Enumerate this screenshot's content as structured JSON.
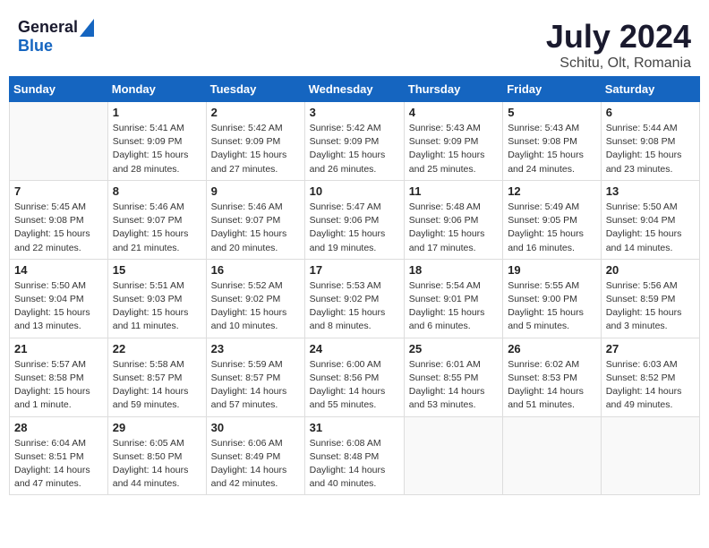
{
  "logo": {
    "general": "General",
    "blue": "Blue"
  },
  "title": "July 2024",
  "location": "Schitu, Olt, Romania",
  "weekdays": [
    "Sunday",
    "Monday",
    "Tuesday",
    "Wednesday",
    "Thursday",
    "Friday",
    "Saturday"
  ],
  "weeks": [
    [
      {
        "day": "",
        "info": ""
      },
      {
        "day": "1",
        "info": "Sunrise: 5:41 AM\nSunset: 9:09 PM\nDaylight: 15 hours\nand 28 minutes."
      },
      {
        "day": "2",
        "info": "Sunrise: 5:42 AM\nSunset: 9:09 PM\nDaylight: 15 hours\nand 27 minutes."
      },
      {
        "day": "3",
        "info": "Sunrise: 5:42 AM\nSunset: 9:09 PM\nDaylight: 15 hours\nand 26 minutes."
      },
      {
        "day": "4",
        "info": "Sunrise: 5:43 AM\nSunset: 9:09 PM\nDaylight: 15 hours\nand 25 minutes."
      },
      {
        "day": "5",
        "info": "Sunrise: 5:43 AM\nSunset: 9:08 PM\nDaylight: 15 hours\nand 24 minutes."
      },
      {
        "day": "6",
        "info": "Sunrise: 5:44 AM\nSunset: 9:08 PM\nDaylight: 15 hours\nand 23 minutes."
      }
    ],
    [
      {
        "day": "7",
        "info": "Sunrise: 5:45 AM\nSunset: 9:08 PM\nDaylight: 15 hours\nand 22 minutes."
      },
      {
        "day": "8",
        "info": "Sunrise: 5:46 AM\nSunset: 9:07 PM\nDaylight: 15 hours\nand 21 minutes."
      },
      {
        "day": "9",
        "info": "Sunrise: 5:46 AM\nSunset: 9:07 PM\nDaylight: 15 hours\nand 20 minutes."
      },
      {
        "day": "10",
        "info": "Sunrise: 5:47 AM\nSunset: 9:06 PM\nDaylight: 15 hours\nand 19 minutes."
      },
      {
        "day": "11",
        "info": "Sunrise: 5:48 AM\nSunset: 9:06 PM\nDaylight: 15 hours\nand 17 minutes."
      },
      {
        "day": "12",
        "info": "Sunrise: 5:49 AM\nSunset: 9:05 PM\nDaylight: 15 hours\nand 16 minutes."
      },
      {
        "day": "13",
        "info": "Sunrise: 5:50 AM\nSunset: 9:04 PM\nDaylight: 15 hours\nand 14 minutes."
      }
    ],
    [
      {
        "day": "14",
        "info": "Sunrise: 5:50 AM\nSunset: 9:04 PM\nDaylight: 15 hours\nand 13 minutes."
      },
      {
        "day": "15",
        "info": "Sunrise: 5:51 AM\nSunset: 9:03 PM\nDaylight: 15 hours\nand 11 minutes."
      },
      {
        "day": "16",
        "info": "Sunrise: 5:52 AM\nSunset: 9:02 PM\nDaylight: 15 hours\nand 10 minutes."
      },
      {
        "day": "17",
        "info": "Sunrise: 5:53 AM\nSunset: 9:02 PM\nDaylight: 15 hours\nand 8 minutes."
      },
      {
        "day": "18",
        "info": "Sunrise: 5:54 AM\nSunset: 9:01 PM\nDaylight: 15 hours\nand 6 minutes."
      },
      {
        "day": "19",
        "info": "Sunrise: 5:55 AM\nSunset: 9:00 PM\nDaylight: 15 hours\nand 5 minutes."
      },
      {
        "day": "20",
        "info": "Sunrise: 5:56 AM\nSunset: 8:59 PM\nDaylight: 15 hours\nand 3 minutes."
      }
    ],
    [
      {
        "day": "21",
        "info": "Sunrise: 5:57 AM\nSunset: 8:58 PM\nDaylight: 15 hours\nand 1 minute."
      },
      {
        "day": "22",
        "info": "Sunrise: 5:58 AM\nSunset: 8:57 PM\nDaylight: 14 hours\nand 59 minutes."
      },
      {
        "day": "23",
        "info": "Sunrise: 5:59 AM\nSunset: 8:57 PM\nDaylight: 14 hours\nand 57 minutes."
      },
      {
        "day": "24",
        "info": "Sunrise: 6:00 AM\nSunset: 8:56 PM\nDaylight: 14 hours\nand 55 minutes."
      },
      {
        "day": "25",
        "info": "Sunrise: 6:01 AM\nSunset: 8:55 PM\nDaylight: 14 hours\nand 53 minutes."
      },
      {
        "day": "26",
        "info": "Sunrise: 6:02 AM\nSunset: 8:53 PM\nDaylight: 14 hours\nand 51 minutes."
      },
      {
        "day": "27",
        "info": "Sunrise: 6:03 AM\nSunset: 8:52 PM\nDaylight: 14 hours\nand 49 minutes."
      }
    ],
    [
      {
        "day": "28",
        "info": "Sunrise: 6:04 AM\nSunset: 8:51 PM\nDaylight: 14 hours\nand 47 minutes."
      },
      {
        "day": "29",
        "info": "Sunrise: 6:05 AM\nSunset: 8:50 PM\nDaylight: 14 hours\nand 44 minutes."
      },
      {
        "day": "30",
        "info": "Sunrise: 6:06 AM\nSunset: 8:49 PM\nDaylight: 14 hours\nand 42 minutes."
      },
      {
        "day": "31",
        "info": "Sunrise: 6:08 AM\nSunset: 8:48 PM\nDaylight: 14 hours\nand 40 minutes."
      },
      {
        "day": "",
        "info": ""
      },
      {
        "day": "",
        "info": ""
      },
      {
        "day": "",
        "info": ""
      }
    ]
  ]
}
